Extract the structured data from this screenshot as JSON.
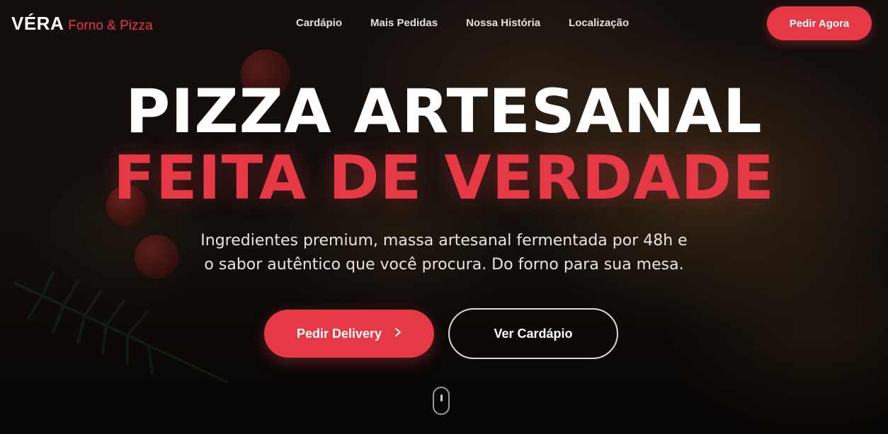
{
  "brand": {
    "name": "VÉRA",
    "tagline": "Forno & Pizza"
  },
  "nav": {
    "items": [
      {
        "label": "Cardápio"
      },
      {
        "label": "Mais Pedidas"
      },
      {
        "label": "Nossa História"
      },
      {
        "label": "Localização"
      }
    ],
    "cta_label": "Pedir Agora"
  },
  "hero": {
    "title_line1": "PIZZA ARTESANAL",
    "title_line2": "FEITA DE VERDADE",
    "subtitle_line1": "Ingredientes premium, massa artesanal fermentada por 48h e",
    "subtitle_line2": "o sabor autêntico que você procura. Do forno para sua mesa.",
    "primary_button": {
      "label": "Pedir Delivery",
      "icon": "chevron-right-icon"
    },
    "secondary_button": {
      "label": "Ver Cardápio"
    },
    "scroll_icon": "mouse-scroll-icon",
    "background_image": "pizza-background-image"
  },
  "colors": {
    "accent": "#e63946",
    "text": "#ffffff",
    "background": "#120d0a"
  }
}
